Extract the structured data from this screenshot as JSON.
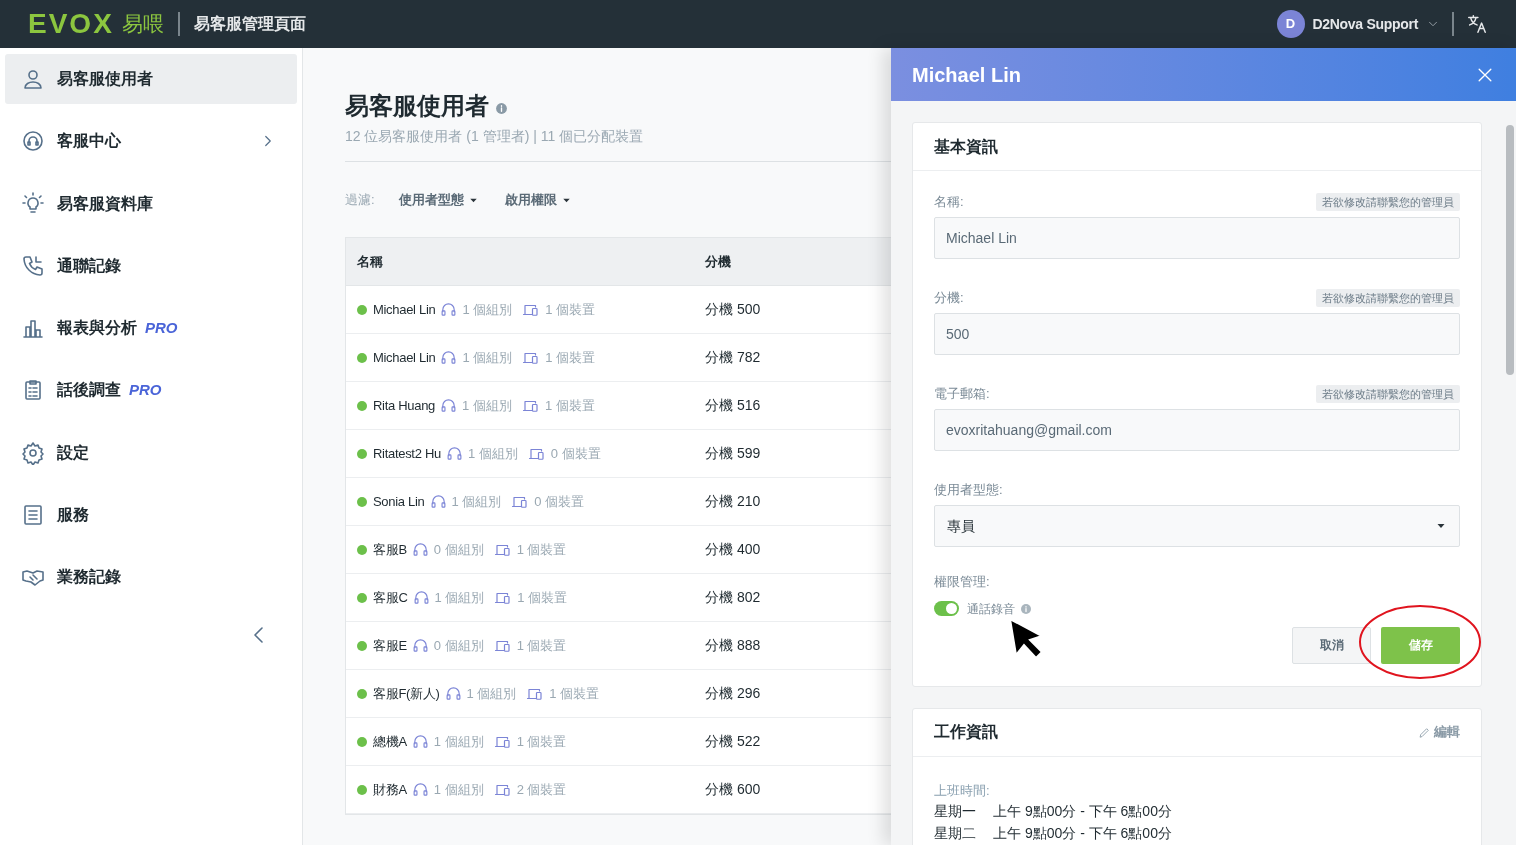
{
  "topbar": {
    "logo": "EVOX",
    "logo_cjk": "易喂",
    "title": "易客服管理頁面",
    "user_initial": "D",
    "user_name": "D2Nova Support"
  },
  "sidebar": {
    "items": [
      {
        "label": "易客服使用者",
        "selected": true
      },
      {
        "label": "客服中心",
        "selected": false,
        "has_children": true
      },
      {
        "label": "易客服資料庫",
        "selected": false
      },
      {
        "label": "通聯記錄",
        "selected": false
      },
      {
        "label": "報表與分析",
        "badge": "PRO",
        "selected": false
      },
      {
        "label": "話後調查",
        "badge": "PRO",
        "selected": false
      },
      {
        "label": "設定",
        "selected": false
      },
      {
        "label": "服務",
        "selected": false
      },
      {
        "label": "業務記錄",
        "selected": false
      }
    ]
  },
  "page": {
    "title": "易客服使用者",
    "subtitle": "12 位易客服使用者 (1 管理者) | 11 個已分配裝置",
    "filter_label": "過濾:",
    "filters": [
      "使用者型態",
      "啟用權限"
    ]
  },
  "table": {
    "columns": [
      "名稱",
      "分機"
    ],
    "rows": [
      {
        "name": "Michael Lin",
        "groups": "1 個組別",
        "devices": "1 個裝置",
        "extension": "分機 500",
        "color": "#6cc04a"
      },
      {
        "name": "Michael Lin",
        "groups": "1 個組別",
        "devices": "1 個裝置",
        "extension": "分機 782",
        "color": "#6cc04a"
      },
      {
        "name": "Rita Huang",
        "groups": "1 個組別",
        "devices": "1 個裝置",
        "extension": "分機 516",
        "color": "#6cc04a"
      },
      {
        "name": "Ritatest2 Hu",
        "groups": "1 個組別",
        "devices": "0 個裝置",
        "extension": "分機 599",
        "color": "#6cc04a"
      },
      {
        "name": "Sonia Lin",
        "groups": "1 個組別",
        "devices": "0 個裝置",
        "extension": "分機 210",
        "color": "#6cc04a"
      },
      {
        "name": "客服B",
        "groups": "0 個組別",
        "devices": "1 個裝置",
        "extension": "分機 400",
        "color": "#6cc04a"
      },
      {
        "name": "客服C",
        "groups": "1 個組別",
        "devices": "1 個裝置",
        "extension": "分機 802",
        "color": "#6cc04a"
      },
      {
        "name": "客服E",
        "groups": "0 個組別",
        "devices": "1 個裝置",
        "extension": "分機 888",
        "color": "#6cc04a"
      },
      {
        "name": "客服F(新人)",
        "groups": "1 個組別",
        "devices": "1 個裝置",
        "extension": "分機 296",
        "color": "#6cc04a"
      },
      {
        "name": "總機A",
        "groups": "1 個組別",
        "devices": "1 個裝置",
        "extension": "分機 522",
        "color": "#6cc04a"
      },
      {
        "name": "財務A",
        "groups": "1 個組別",
        "devices": "2 個裝置",
        "extension": "分機 600",
        "color": "#6cc04a"
      }
    ]
  },
  "drawer": {
    "title": "Michael Lin",
    "basic": {
      "heading": "基本資訊",
      "fields": [
        {
          "kind": "text",
          "label": "名稱:",
          "hint": "若欲修改請聯繫您的管理員",
          "value": "Michael Lin"
        },
        {
          "kind": "text",
          "label": "分機:",
          "hint": "若欲修改請聯繫您的管理員",
          "value": "500"
        },
        {
          "kind": "text",
          "label": "電子郵箱:",
          "hint": "若欲修改請聯繫您的管理員",
          "value": "evoxritahuang@gmail.com"
        },
        {
          "kind": "select",
          "label": "使用者型態:",
          "value": "專員"
        }
      ],
      "permissions_label": "權限管理:",
      "permissions": [
        {
          "label": "通話錄音",
          "on": true
        }
      ],
      "buttons": [
        "取消",
        "儲存"
      ]
    },
    "work": {
      "heading": "工作資訊",
      "edit": "編輯",
      "hours_label": "上班時間:",
      "hours": [
        {
          "day": "星期一",
          "time": "上午 9點00分 - 下午 6點00分"
        },
        {
          "day": "星期二",
          "time": "上午 9點00分 - 下午 6點00分"
        }
      ]
    }
  }
}
